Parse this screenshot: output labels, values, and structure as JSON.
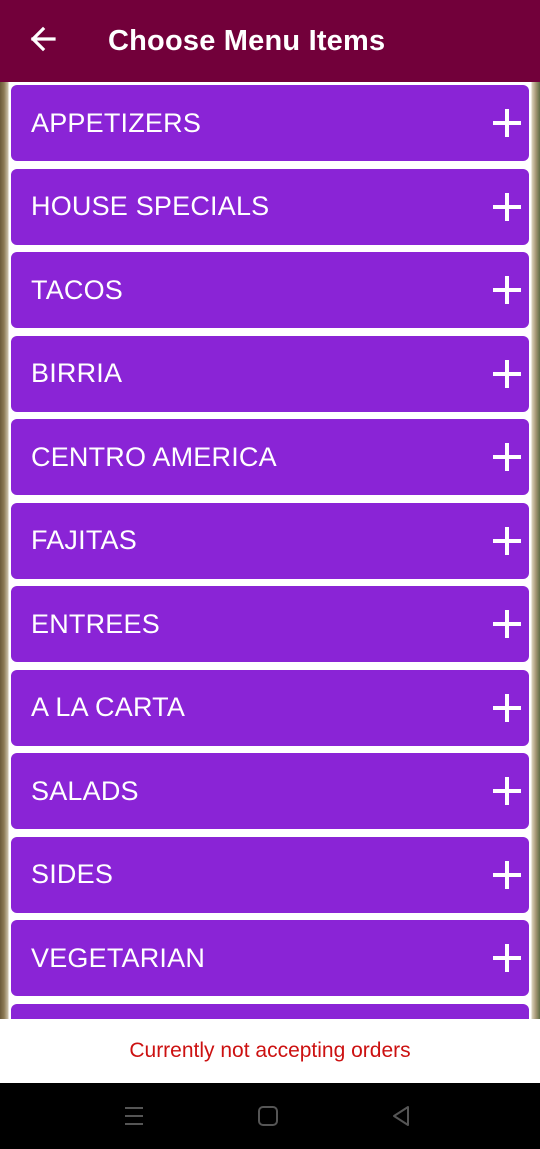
{
  "app_bar": {
    "title": "Choose Menu Items",
    "back_icon": "arrow-left-icon",
    "background": "#72003a"
  },
  "categories": [
    {
      "label": "APPETIZERS"
    },
    {
      "label": "HOUSE SPECIALS"
    },
    {
      "label": "TACOS"
    },
    {
      "label": "BIRRIA"
    },
    {
      "label": "CENTRO AMERICA"
    },
    {
      "label": "FAJITAS"
    },
    {
      "label": "ENTREES"
    },
    {
      "label": "A LA CARTA"
    },
    {
      "label": "SALADS"
    },
    {
      "label": "SIDES"
    },
    {
      "label": "VEGETARIAN"
    },
    {
      "label": ""
    }
  ],
  "category_style": {
    "background": "#8a24d6",
    "expand_icon": "plus-icon"
  },
  "status": {
    "message": "Currently not accepting orders",
    "color": "#cc1111"
  },
  "system_nav": {
    "menu_icon": "recent-apps-icon",
    "home_icon": "home-icon",
    "back_icon": "back-triangle-icon"
  }
}
